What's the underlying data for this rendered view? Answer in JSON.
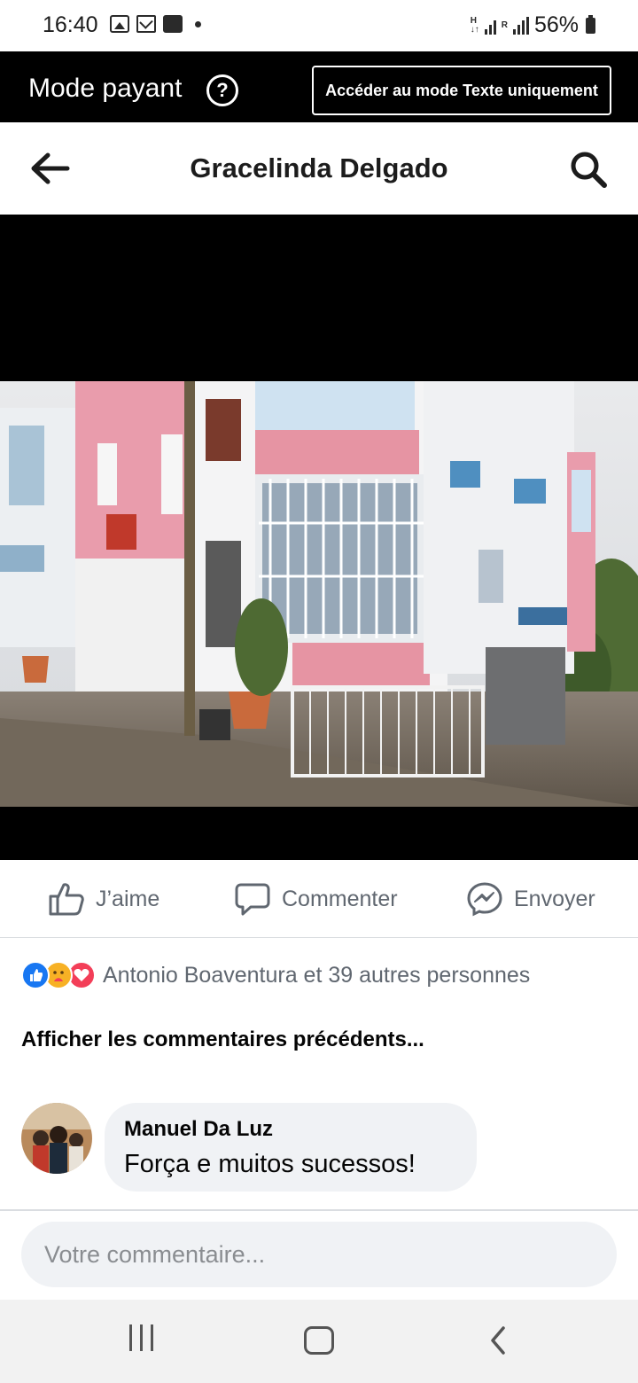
{
  "status_bar": {
    "time": "16:40",
    "battery": "56%",
    "icons": [
      "gallery-icon",
      "gmail-icon",
      "card-icon",
      "dot-icon",
      "signal-icon",
      "battery-icon"
    ]
  },
  "mode_bar": {
    "title": "Mode payant",
    "help_icon": "?",
    "button_label": "Accéder au mode Texte uniquement"
  },
  "header": {
    "title": "Gracelinda Delgado"
  },
  "actions": {
    "like": "J’aime",
    "comment": "Commenter",
    "send": "Envoyer"
  },
  "reactions": {
    "text": "Antonio Boaventura et 39 autres personnes",
    "types": [
      "like",
      "care",
      "love"
    ]
  },
  "comments": {
    "previous_label": "Afficher les commentaires précédents...",
    "items": [
      {
        "author": "Manuel Da Luz",
        "text": "Força e muitos sucessos!"
      }
    ]
  },
  "composer": {
    "placeholder": "Votre commentaire..."
  },
  "colors": {
    "accent": "#1877f2",
    "bubble": "#f0f2f5",
    "secondary_text": "#606770"
  }
}
